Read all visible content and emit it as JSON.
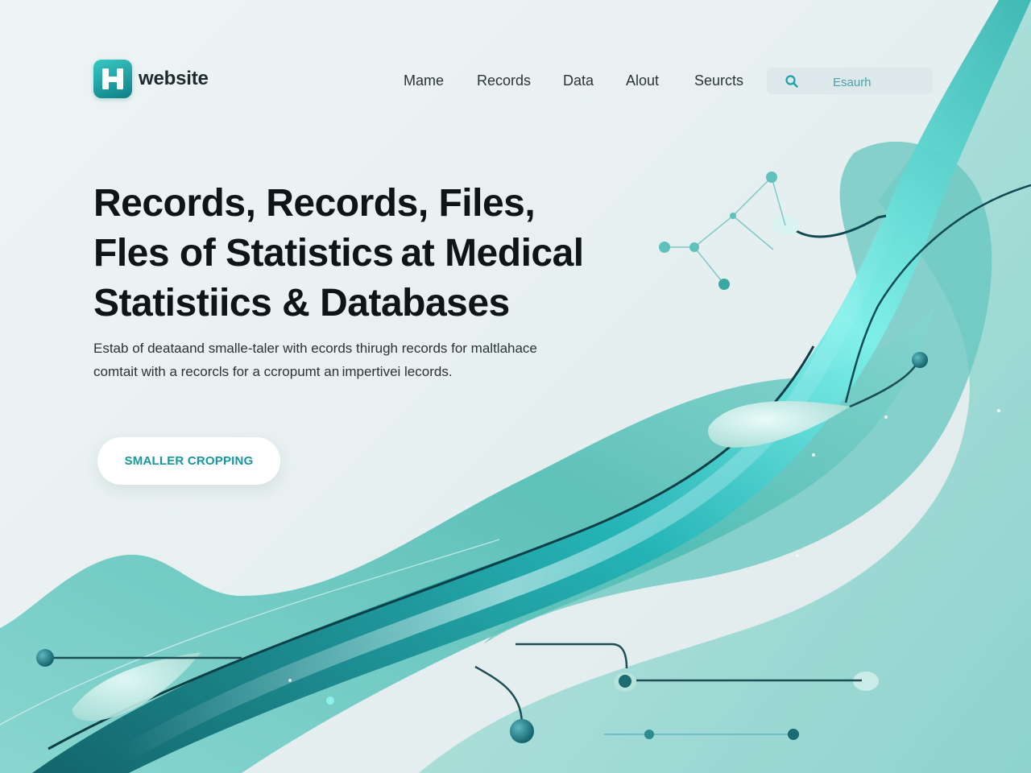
{
  "header": {
    "logo_text": "website",
    "nav": [
      "Mame",
      "Records",
      "Data",
      "Alout",
      "Seurcts"
    ],
    "search_placeholder": "Esaurh"
  },
  "hero": {
    "headline_lines": [
      "Records, Records, Files,",
      "Fles of Statistics at Medical",
      "Statistiics & Databases"
    ],
    "subtext_lines": [
      "Estab of deataand smalle-taler with ecords thirugh records  for maltlahace",
      "comtait with a recorcls for a ccropumt  an impertivei lecords."
    ],
    "cta_label": "SMALLER CROPPING"
  },
  "colors": {
    "accent": "#1596a0",
    "teal_light": "#9fdcd6",
    "teal_mid": "#57c4bf",
    "teal_dark": "#0f6f78",
    "background": "#e8f0f0"
  },
  "icons": {
    "logo": "hospital-h-icon",
    "search": "search-icon"
  }
}
